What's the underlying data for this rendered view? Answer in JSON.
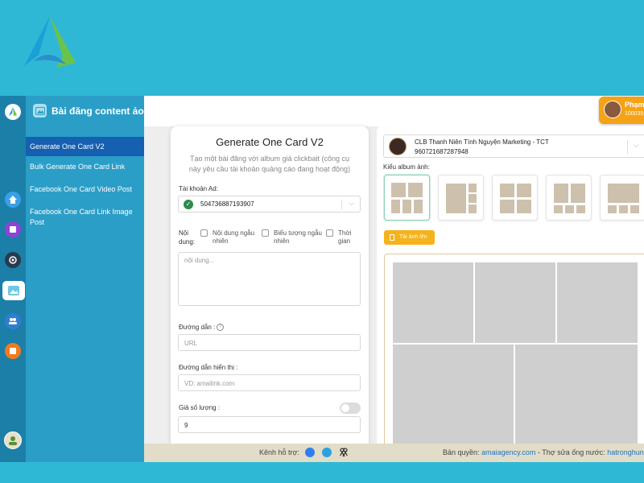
{
  "brand": {
    "logo": "brand-logo-triangle",
    "color_primary": "#2fb8d6",
    "color_accent": "#1560b0"
  },
  "sidebar": {
    "header_title": "Bài đăng content ảo",
    "header_icon": "image-icon",
    "items": [
      {
        "label": "Generate One Card V2",
        "active": true
      },
      {
        "label": "Bulk Generate One Card Link",
        "active": false
      },
      {
        "label": "Facebook One Card Video Post",
        "active": false
      },
      {
        "label": "Facebook One Card Link Image Post",
        "active": false
      }
    ]
  },
  "iconbar": {
    "icons": [
      "logo-icon",
      "home-icon",
      "tablet-icon",
      "camera-icon",
      "image-icon",
      "users-icon",
      "chat-icon",
      "avatar-icon"
    ]
  },
  "user": {
    "name": "Phạm",
    "id": "100035"
  },
  "form": {
    "title": "Generate One Card V2",
    "subtitle": "Tạo một bài đăng với album giả clickbait (công cụ này yêu cầu tài khoản quảng cáo đang hoạt động)",
    "ad_account_label": "Tài khoản Ad:",
    "ad_account_value": "504736887193907",
    "content_label": "Nội dung:",
    "options": [
      {
        "label": "Nội dung ngẫu nhiên",
        "checked": false
      },
      {
        "label": "Biểu tượng ngẫu nhiên",
        "checked": false
      },
      {
        "label": "Thời gian",
        "checked": false
      }
    ],
    "content_placeholder": "nội dung...",
    "link_label": "Đường dẫn :",
    "link_placeholder": "URL",
    "display_link_label": "Đường dẫn hiển thị :",
    "display_link_placeholder": "VD: amailink.com",
    "fake_count_label": "Giả số lượng :",
    "fake_count_enabled": false,
    "fake_count_value": "9"
  },
  "page": {
    "name": "CLB Thanh Niên Tình Nguyện Marketing - TCT",
    "id": "960721687287948"
  },
  "album": {
    "label": "Kiểu album ảnh:",
    "layouts": [
      "layout-1",
      "layout-2",
      "layout-3",
      "layout-4",
      "layout-5"
    ],
    "selected": 0
  },
  "upload_label": "Tải ảnh lên",
  "footer": {
    "support_label": "Kênh hỗ trợ:",
    "support_icons": [
      "facebook-icon",
      "telegram-icon",
      "group-icon"
    ],
    "copyright_prefix": "Bản quyền:",
    "copyright_link": "amaiagency.com",
    "separator": "-",
    "plumber_prefix": "Thợ sửa ống nước:",
    "plumber_link": "hatronghung"
  }
}
